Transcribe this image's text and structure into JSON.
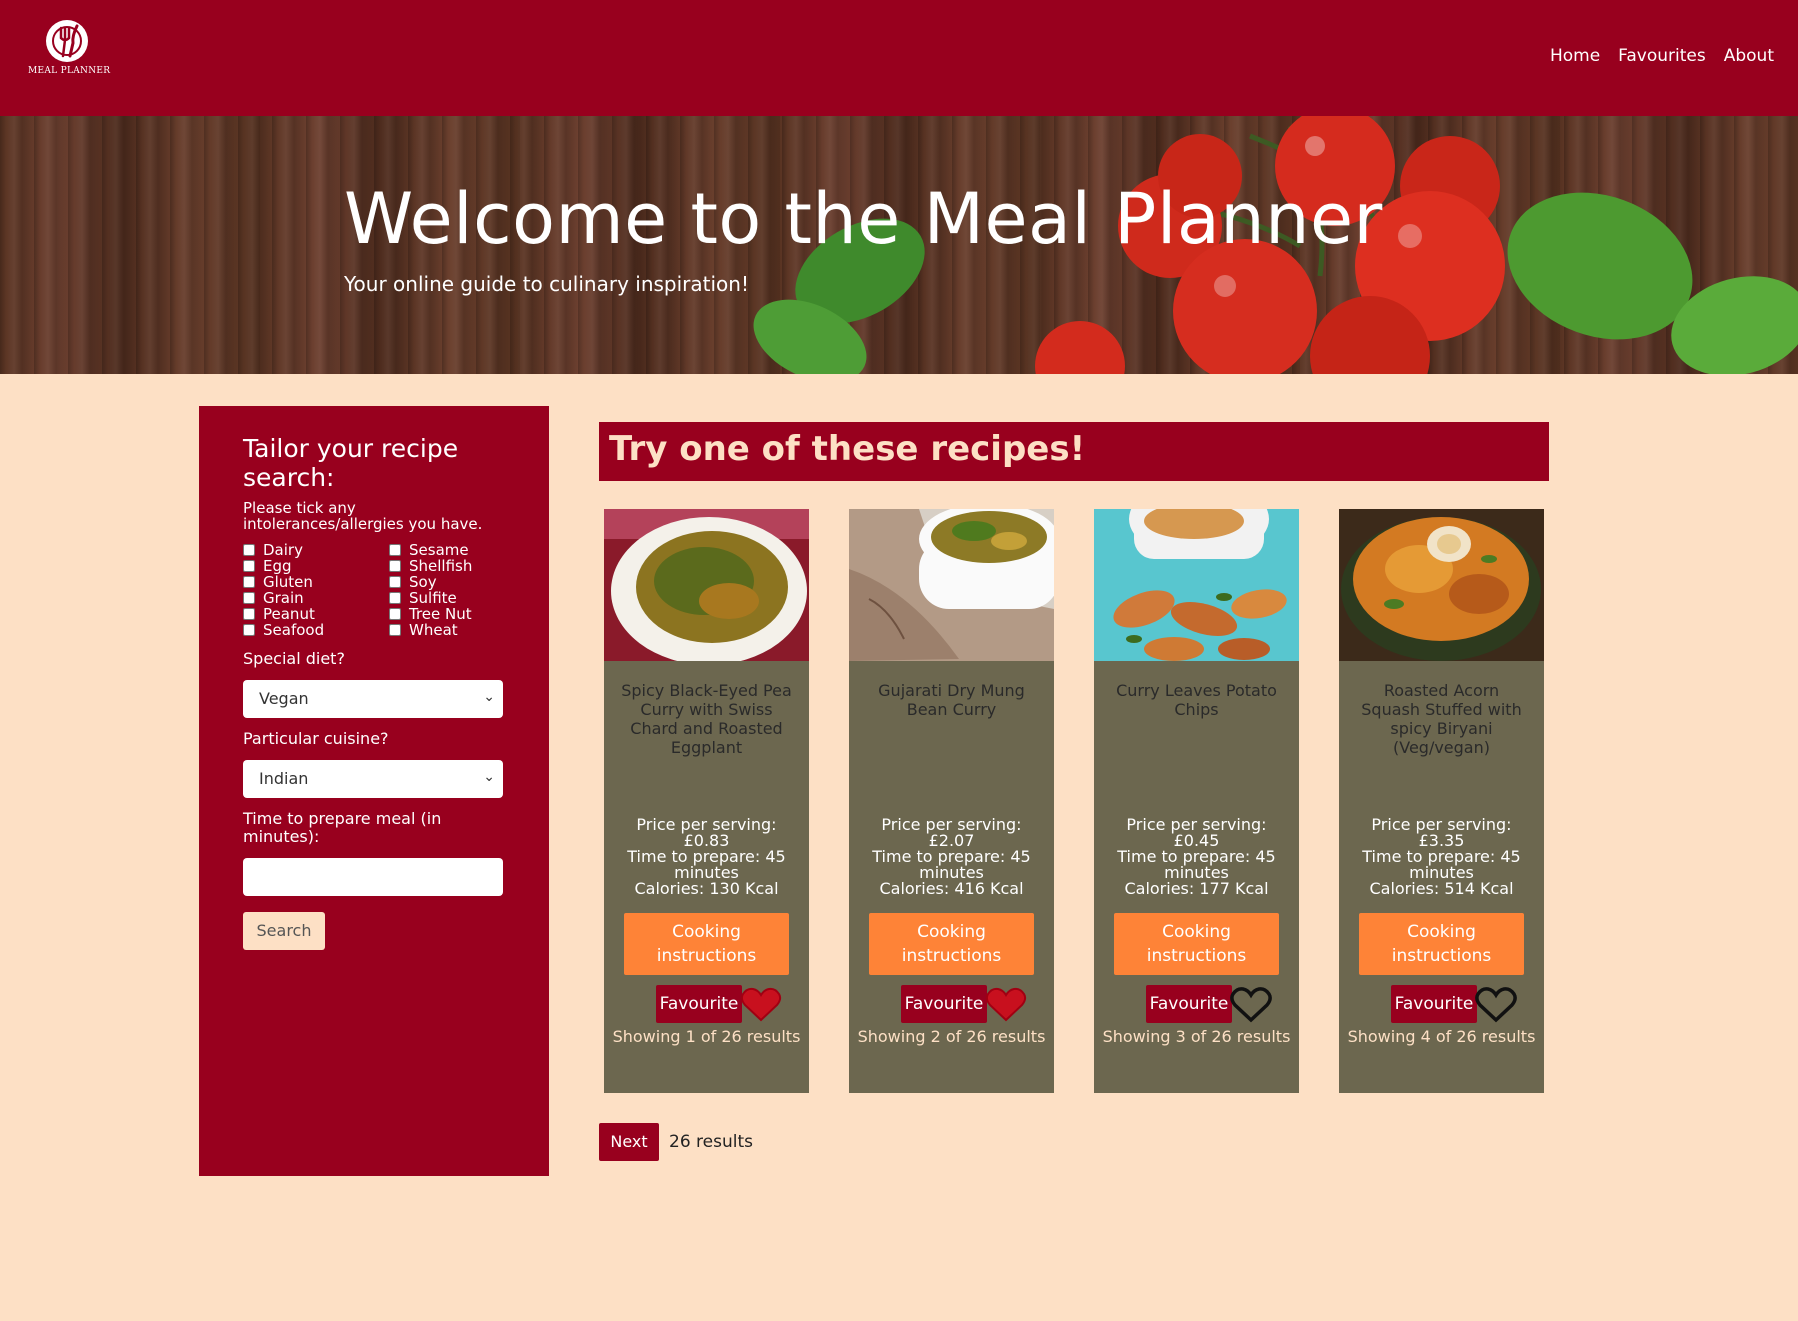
{
  "header": {
    "logo_text": "MEAL PLANNER",
    "nav": [
      "Home",
      "Favourites",
      "About"
    ]
  },
  "hero": {
    "title": "Welcome to the Meal Planner",
    "subtitle": "Your online guide to culinary inspiration!"
  },
  "sidebar": {
    "title": "Tailor your recipe search:",
    "note": "Please tick any intolerances/allergies you have.",
    "allergies_col1": [
      "Dairy",
      "Egg",
      "Gluten",
      "Grain",
      "Peanut",
      "Seafood"
    ],
    "allergies_col2": [
      "Sesame",
      "Shellfish",
      "Soy",
      "Sulfite",
      "Tree Nut",
      "Wheat"
    ],
    "diet_label": "Special diet?",
    "diet_value": "Vegan",
    "cuisine_label": "Particular cuisine?",
    "cuisine_value": "Indian",
    "time_label": "Time to prepare meal (in minutes):",
    "time_value": "",
    "search_label": "Search"
  },
  "main": {
    "banner": "Try one of these recipes!",
    "recipes": [
      {
        "name": "Spicy Black-Eyed Pea Curry with Swiss Chard and Roasted Eggplant",
        "price_label": "Price per serving:",
        "price": "£0.83",
        "time": "Time to prepare: 45 minutes",
        "calories": "Calories: 130 Kcal",
        "cook_label": "Cooking instructions",
        "fav_label": "Favourite",
        "favourited": true,
        "showing": "Showing 1 of 26 results"
      },
      {
        "name": "Gujarati Dry Mung Bean Curry",
        "price_label": "Price per serving:",
        "price": "£2.07",
        "time": "Time to prepare: 45 minutes",
        "calories": "Calories: 416 Kcal",
        "cook_label": "Cooking instructions",
        "fav_label": "Favourite",
        "favourited": true,
        "showing": "Showing 2 of 26 results"
      },
      {
        "name": "Curry Leaves Potato Chips",
        "price_label": "Price per serving:",
        "price": "£0.45",
        "time": "Time to prepare: 45 minutes",
        "calories": "Calories: 177 Kcal",
        "cook_label": "Cooking instructions",
        "fav_label": "Favourite",
        "favourited": false,
        "showing": "Showing 3 of 26 results"
      },
      {
        "name": "Roasted Acorn Squash Stuffed with spicy Biryani (Veg/vegan)",
        "price_label": "Price per serving:",
        "price": "£3.35",
        "time": "Time to prepare: 45 minutes",
        "calories": "Calories: 514 Kcal",
        "cook_label": "Cooking instructions",
        "fav_label": "Favourite",
        "favourited": false,
        "showing": "Showing 4 of 26 results"
      }
    ],
    "next_label": "Next",
    "results_count": "26 results"
  },
  "colors": {
    "brand": "#98001e",
    "background": "#fde0c5",
    "card": "#6c674f",
    "accent": "#fe8337"
  },
  "icons": [
    "logo-icon",
    "heart-icon",
    "chevron-down-icon"
  ]
}
